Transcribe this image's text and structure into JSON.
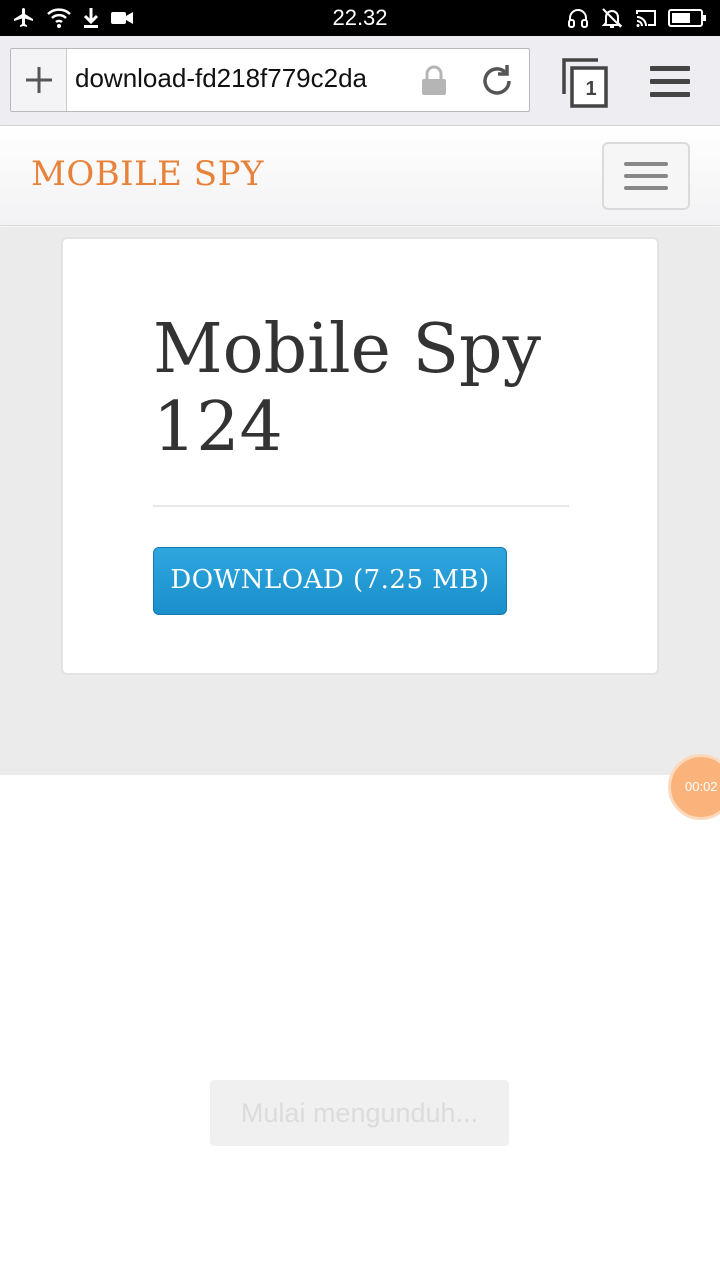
{
  "status_bar": {
    "time": "22.32",
    "left_icons": [
      "airplane-icon",
      "wifi-icon",
      "download-icon",
      "video-icon"
    ],
    "right_icons": [
      "headset-icon",
      "notifications-off-icon",
      "cast-icon",
      "battery-icon"
    ]
  },
  "browser": {
    "url": "download-fd218f779c2da",
    "tab_count": "1"
  },
  "site": {
    "brand": "MOBILE SPY"
  },
  "card": {
    "title": "Mobile Spy 124",
    "download_label": "DOWNLOAD (7.25 MB)"
  },
  "timer": {
    "label": "00:02"
  },
  "toast": {
    "message": "Mulai mengunduh..."
  },
  "colors": {
    "brand": "#e8823a",
    "download_button": "#2199d5",
    "page_background": "#ebebec",
    "timer_bubble": "#fbb37c"
  }
}
